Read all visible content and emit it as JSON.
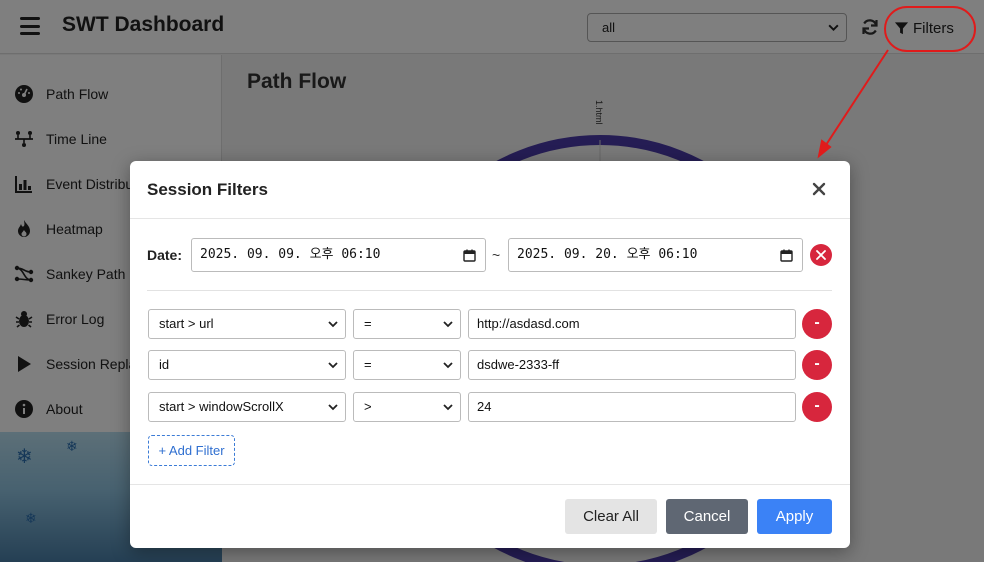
{
  "app": {
    "title": "SWT Dashboard",
    "filter_select_value": "all",
    "filters_label": "Filters"
  },
  "sidebar": {
    "items": [
      {
        "label": "Path Flow",
        "icon": "dashboard-gauge-icon"
      },
      {
        "label": "Time Line",
        "icon": "timeline-icon"
      },
      {
        "label": "Event Distribution",
        "icon": "bar-chart-icon"
      },
      {
        "label": "Heatmap",
        "icon": "fire-icon"
      },
      {
        "label": "Sankey Path Diagram",
        "icon": "sankey-icon"
      },
      {
        "label": "Error Log",
        "icon": "bug-icon"
      },
      {
        "label": "Session Replay",
        "icon": "play-icon"
      },
      {
        "label": "About",
        "icon": "info-icon"
      }
    ]
  },
  "main": {
    "title": "Path Flow",
    "chart_axis_label": "1.html"
  },
  "modal": {
    "title": "Session Filters",
    "date_label": "Date:",
    "date_from": "2025. 09. 09. 오후 06:10",
    "date_to": "2025. 09. 20. 오후 06:10",
    "date_separator": "~",
    "filters": [
      {
        "field": "start > url",
        "operator": "=",
        "value": "http://asdasd.com"
      },
      {
        "field": "id",
        "operator": "=",
        "value": "dsdwe-2333-ff"
      },
      {
        "field": "start > windowScrollX",
        "operator": ">",
        "value": "24"
      }
    ],
    "remove_label": "-",
    "add_filter_label": "+ Add Filter",
    "buttons": {
      "clear_all": "Clear All",
      "cancel": "Cancel",
      "apply": "Apply"
    }
  },
  "colors": {
    "accent": "#3b82f6",
    "danger": "#d7263d",
    "annotation": "#e01b1b",
    "chart_ring": "#4b3aa8"
  }
}
